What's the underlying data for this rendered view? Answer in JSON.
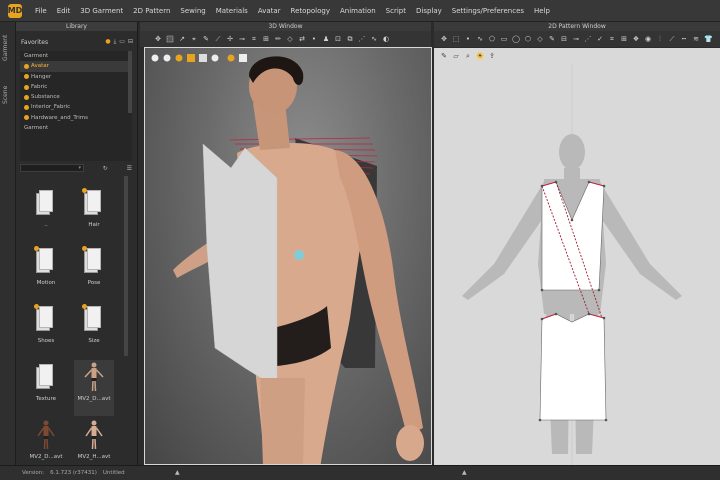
{
  "app": {
    "logo_text": "MD"
  },
  "menu": [
    "File",
    "Edit",
    "3D Garment",
    "2D Pattern",
    "Sewing",
    "Materials",
    "Avatar",
    "Retopology",
    "Animation",
    "Script",
    "Display",
    "Settings/Preferences",
    "Help"
  ],
  "left_tabs": {
    "tab1": "Garment",
    "tab2": "Scene"
  },
  "library": {
    "title": "Library",
    "favorites_label": "Favorites",
    "tree": [
      {
        "label": "Garment",
        "dot": false,
        "selected": false
      },
      {
        "label": "Avatar",
        "dot": true,
        "selected": true
      },
      {
        "label": "Hanger",
        "dot": true,
        "selected": false
      },
      {
        "label": "Fabric",
        "dot": true,
        "selected": false
      },
      {
        "label": "Substance",
        "dot": true,
        "selected": false
      },
      {
        "label": "Interior_Fabric",
        "dot": true,
        "selected": false
      },
      {
        "label": "Hardware_and_Trims",
        "dot": true,
        "selected": false
      },
      {
        "label": "Garment",
        "dot": false,
        "selected": false
      }
    ],
    "items": [
      {
        "label": "..",
        "kind": "folder",
        "badge": false
      },
      {
        "label": "Hair",
        "kind": "folder",
        "badge": true
      },
      {
        "label": "Motion",
        "kind": "folder",
        "badge": true
      },
      {
        "label": "Pose",
        "kind": "folder",
        "badge": true
      },
      {
        "label": "Shoes",
        "kind": "folder",
        "badge": true
      },
      {
        "label": "Size",
        "kind": "folder",
        "badge": true
      },
      {
        "label": "Texture",
        "kind": "folder",
        "badge": false
      },
      {
        "label": "MV2_D...avt",
        "kind": "avatar",
        "badge": false
      },
      {
        "label": "MV2_D...avt",
        "kind": "avatar",
        "badge": false
      },
      {
        "label": "MV2_H...avt",
        "kind": "avatar",
        "badge": false
      }
    ]
  },
  "window3d": {
    "title": "3D Window"
  },
  "window2d": {
    "title": "2D Pattern Window"
  },
  "status": {
    "version_label": "Version:",
    "version": "6.1.723 (r37431)",
    "file": "Untitled"
  },
  "colors": {
    "accent": "#e8a31f",
    "selection": "#ffb43a",
    "pattern_stitch": "#c0223c"
  }
}
